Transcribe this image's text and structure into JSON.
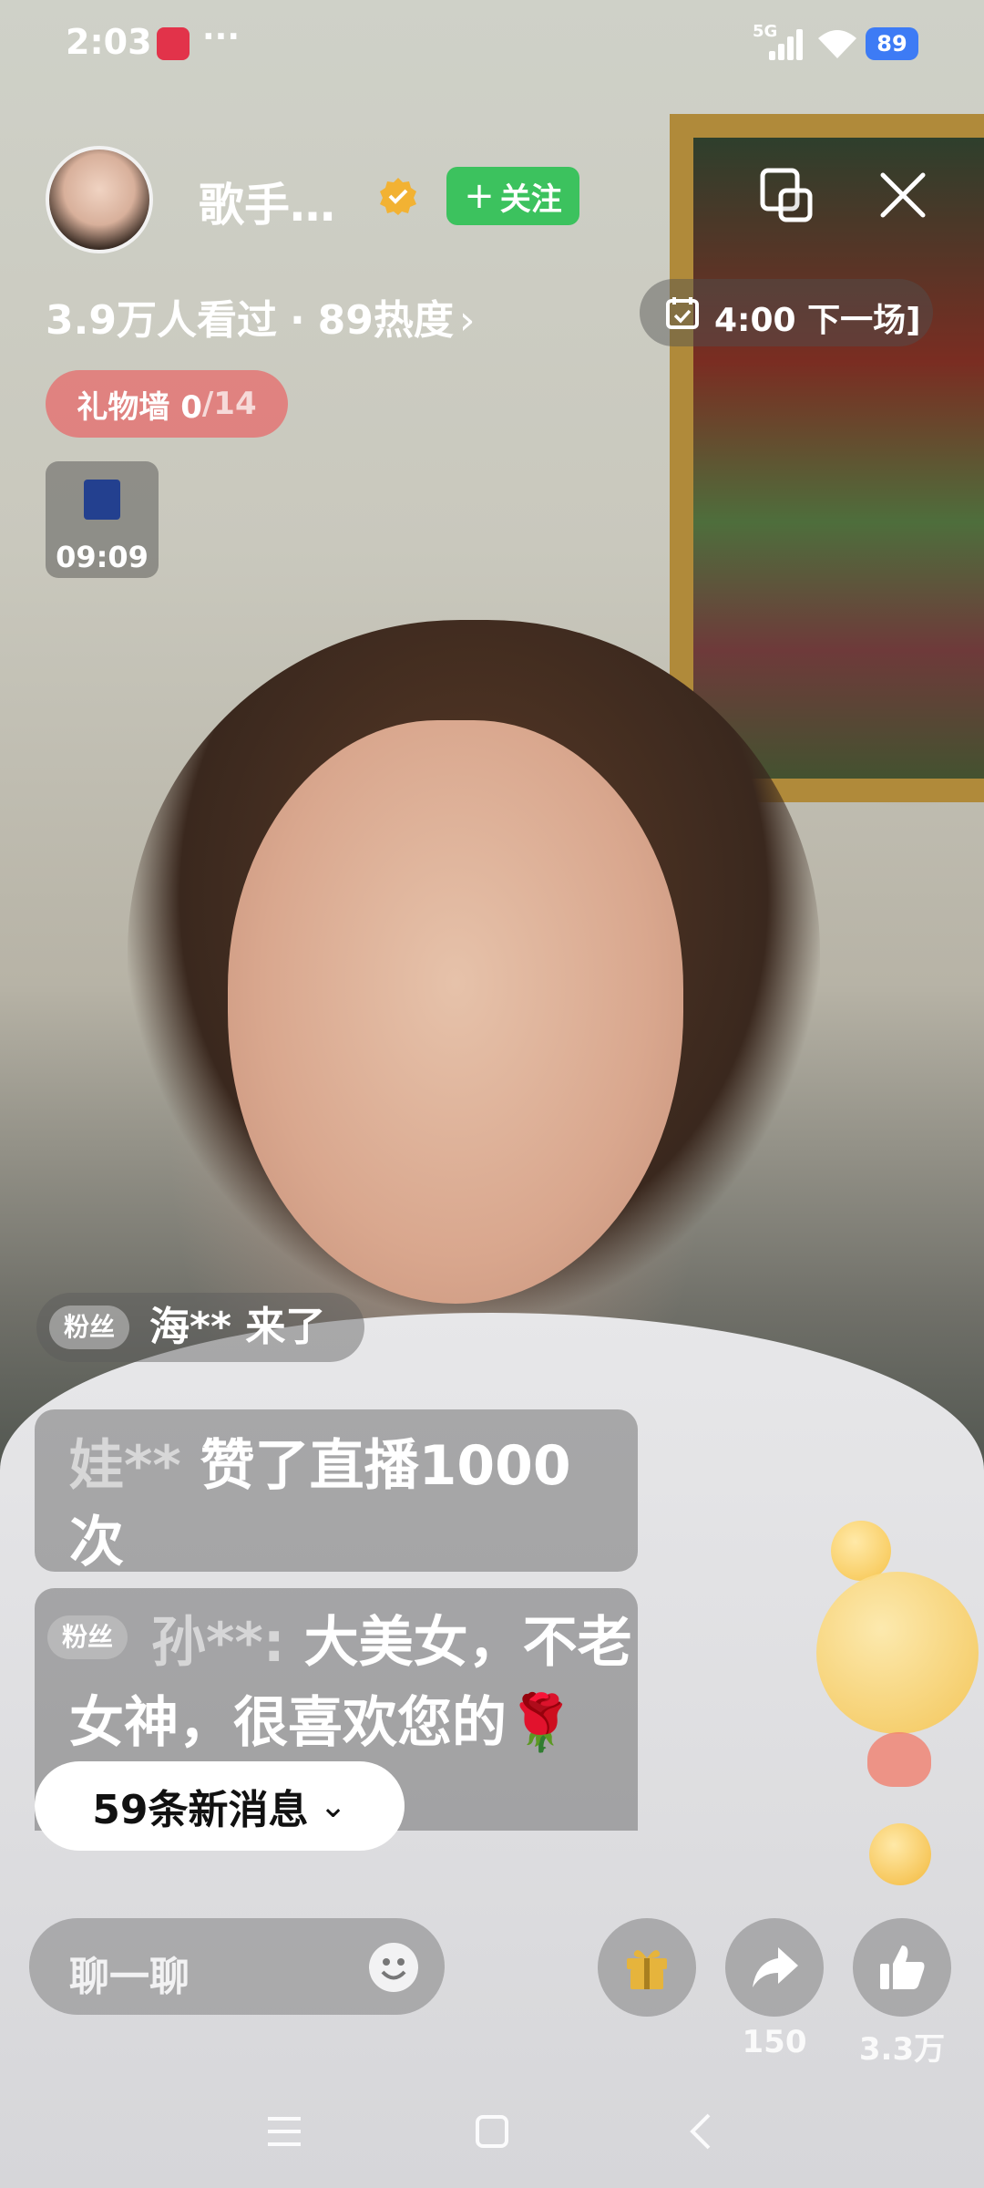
{
  "status_bar": {
    "time": "2:03",
    "dots": "···",
    "network": "5G",
    "battery": "89"
  },
  "header": {
    "streamer_name": "歌手…",
    "follow_label": "关注",
    "follow_plus": "+",
    "viewers": "3.9万人看过",
    "separator": "·",
    "heat": "89热度",
    "heat_chevron": "›",
    "schedule": "4:00  下一场]"
  },
  "gift_wall": {
    "label": "礼物墙 0",
    "total": "/14"
  },
  "timer": {
    "time": "09:09"
  },
  "chat": {
    "fan_badge": "粉丝",
    "join": {
      "user": "海**",
      "text": "来了"
    },
    "like": {
      "user": "娃**",
      "text": "赞了直播1000次"
    },
    "comment": {
      "user": "孙**:",
      "text": "大美女，不老女神，很喜欢您的🌹🌹🌹🌹🌹"
    },
    "new_messages": "59条新消息",
    "new_messages_chevron": "⌄"
  },
  "bottom_bar": {
    "input_placeholder": "聊一聊",
    "share_count": "150",
    "like_count": "3.3万"
  },
  "colors": {
    "follow_green": "#3cc25e",
    "gift_wall_red": "#e66e6e",
    "battery_blue": "#3d7bf5"
  },
  "icons": [
    "smile-icon",
    "gift-icon",
    "share-icon",
    "thumbs-up-icon",
    "pip-icon",
    "close-icon",
    "calendar-icon",
    "verified-icon"
  ]
}
